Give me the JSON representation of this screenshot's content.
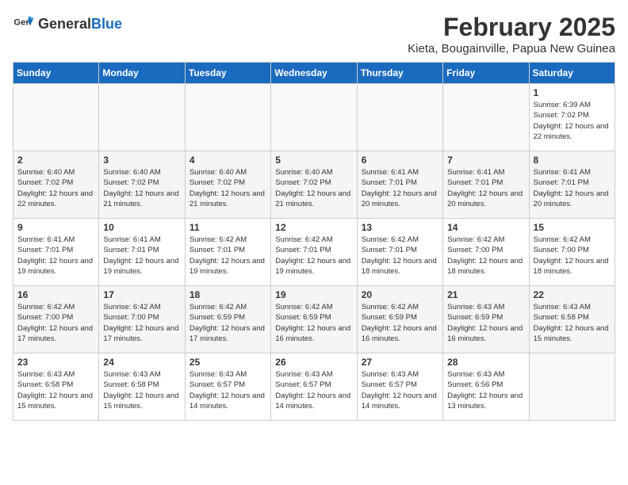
{
  "header": {
    "logo_general": "General",
    "logo_blue": "Blue",
    "month_year": "February 2025",
    "location": "Kieta, Bougainville, Papua New Guinea"
  },
  "days_of_week": [
    "Sunday",
    "Monday",
    "Tuesday",
    "Wednesday",
    "Thursday",
    "Friday",
    "Saturday"
  ],
  "weeks": [
    [
      {
        "day": "",
        "sunrise": "",
        "sunset": "",
        "daylight": ""
      },
      {
        "day": "",
        "sunrise": "",
        "sunset": "",
        "daylight": ""
      },
      {
        "day": "",
        "sunrise": "",
        "sunset": "",
        "daylight": ""
      },
      {
        "day": "",
        "sunrise": "",
        "sunset": "",
        "daylight": ""
      },
      {
        "day": "",
        "sunrise": "",
        "sunset": "",
        "daylight": ""
      },
      {
        "day": "",
        "sunrise": "",
        "sunset": "",
        "daylight": ""
      },
      {
        "day": "1",
        "sunrise": "Sunrise: 6:39 AM",
        "sunset": "Sunset: 7:02 PM",
        "daylight": "Daylight: 12 hours and 22 minutes."
      }
    ],
    [
      {
        "day": "2",
        "sunrise": "Sunrise: 6:40 AM",
        "sunset": "Sunset: 7:02 PM",
        "daylight": "Daylight: 12 hours and 22 minutes."
      },
      {
        "day": "3",
        "sunrise": "Sunrise: 6:40 AM",
        "sunset": "Sunset: 7:02 PM",
        "daylight": "Daylight: 12 hours and 21 minutes."
      },
      {
        "day": "4",
        "sunrise": "Sunrise: 6:40 AM",
        "sunset": "Sunset: 7:02 PM",
        "daylight": "Daylight: 12 hours and 21 minutes."
      },
      {
        "day": "5",
        "sunrise": "Sunrise: 6:40 AM",
        "sunset": "Sunset: 7:02 PM",
        "daylight": "Daylight: 12 hours and 21 minutes."
      },
      {
        "day": "6",
        "sunrise": "Sunrise: 6:41 AM",
        "sunset": "Sunset: 7:01 PM",
        "daylight": "Daylight: 12 hours and 20 minutes."
      },
      {
        "day": "7",
        "sunrise": "Sunrise: 6:41 AM",
        "sunset": "Sunset: 7:01 PM",
        "daylight": "Daylight: 12 hours and 20 minutes."
      },
      {
        "day": "8",
        "sunrise": "Sunrise: 6:41 AM",
        "sunset": "Sunset: 7:01 PM",
        "daylight": "Daylight: 12 hours and 20 minutes."
      }
    ],
    [
      {
        "day": "9",
        "sunrise": "Sunrise: 6:41 AM",
        "sunset": "Sunset: 7:01 PM",
        "daylight": "Daylight: 12 hours and 19 minutes."
      },
      {
        "day": "10",
        "sunrise": "Sunrise: 6:41 AM",
        "sunset": "Sunset: 7:01 PM",
        "daylight": "Daylight: 12 hours and 19 minutes."
      },
      {
        "day": "11",
        "sunrise": "Sunrise: 6:42 AM",
        "sunset": "Sunset: 7:01 PM",
        "daylight": "Daylight: 12 hours and 19 minutes."
      },
      {
        "day": "12",
        "sunrise": "Sunrise: 6:42 AM",
        "sunset": "Sunset: 7:01 PM",
        "daylight": "Daylight: 12 hours and 19 minutes."
      },
      {
        "day": "13",
        "sunrise": "Sunrise: 6:42 AM",
        "sunset": "Sunset: 7:01 PM",
        "daylight": "Daylight: 12 hours and 18 minutes."
      },
      {
        "day": "14",
        "sunrise": "Sunrise: 6:42 AM",
        "sunset": "Sunset: 7:00 PM",
        "daylight": "Daylight: 12 hours and 18 minutes."
      },
      {
        "day": "15",
        "sunrise": "Sunrise: 6:42 AM",
        "sunset": "Sunset: 7:00 PM",
        "daylight": "Daylight: 12 hours and 18 minutes."
      }
    ],
    [
      {
        "day": "16",
        "sunrise": "Sunrise: 6:42 AM",
        "sunset": "Sunset: 7:00 PM",
        "daylight": "Daylight: 12 hours and 17 minutes."
      },
      {
        "day": "17",
        "sunrise": "Sunrise: 6:42 AM",
        "sunset": "Sunset: 7:00 PM",
        "daylight": "Daylight: 12 hours and 17 minutes."
      },
      {
        "day": "18",
        "sunrise": "Sunrise: 6:42 AM",
        "sunset": "Sunset: 6:59 PM",
        "daylight": "Daylight: 12 hours and 17 minutes."
      },
      {
        "day": "19",
        "sunrise": "Sunrise: 6:42 AM",
        "sunset": "Sunset: 6:59 PM",
        "daylight": "Daylight: 12 hours and 16 minutes."
      },
      {
        "day": "20",
        "sunrise": "Sunrise: 6:42 AM",
        "sunset": "Sunset: 6:59 PM",
        "daylight": "Daylight: 12 hours and 16 minutes."
      },
      {
        "day": "21",
        "sunrise": "Sunrise: 6:43 AM",
        "sunset": "Sunset: 6:59 PM",
        "daylight": "Daylight: 12 hours and 16 minutes."
      },
      {
        "day": "22",
        "sunrise": "Sunrise: 6:43 AM",
        "sunset": "Sunset: 6:58 PM",
        "daylight": "Daylight: 12 hours and 15 minutes."
      }
    ],
    [
      {
        "day": "23",
        "sunrise": "Sunrise: 6:43 AM",
        "sunset": "Sunset: 6:58 PM",
        "daylight": "Daylight: 12 hours and 15 minutes."
      },
      {
        "day": "24",
        "sunrise": "Sunrise: 6:43 AM",
        "sunset": "Sunset: 6:58 PM",
        "daylight": "Daylight: 12 hours and 15 minutes."
      },
      {
        "day": "25",
        "sunrise": "Sunrise: 6:43 AM",
        "sunset": "Sunset: 6:57 PM",
        "daylight": "Daylight: 12 hours and 14 minutes."
      },
      {
        "day": "26",
        "sunrise": "Sunrise: 6:43 AM",
        "sunset": "Sunset: 6:57 PM",
        "daylight": "Daylight: 12 hours and 14 minutes."
      },
      {
        "day": "27",
        "sunrise": "Sunrise: 6:43 AM",
        "sunset": "Sunset: 6:57 PM",
        "daylight": "Daylight: 12 hours and 14 minutes."
      },
      {
        "day": "28",
        "sunrise": "Sunrise: 6:43 AM",
        "sunset": "Sunset: 6:56 PM",
        "daylight": "Daylight: 12 hours and 13 minutes."
      },
      {
        "day": "",
        "sunrise": "",
        "sunset": "",
        "daylight": ""
      }
    ]
  ]
}
